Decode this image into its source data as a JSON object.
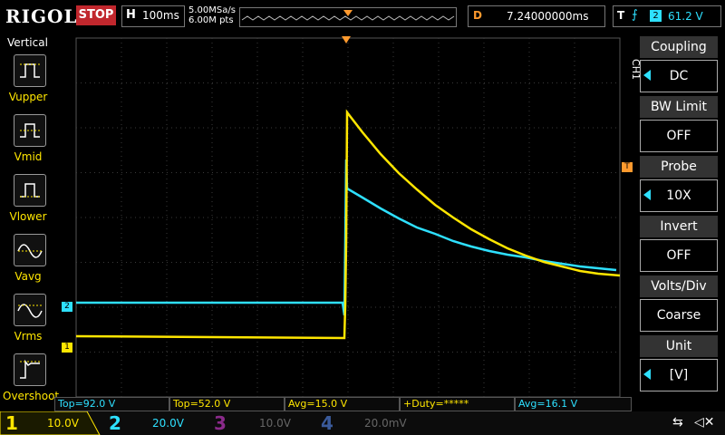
{
  "header": {
    "brand": "RIGOL",
    "run_state": "STOP",
    "timebase_key": "H",
    "timebase_value": "100ms",
    "sample_rate": "5.00MSa/s",
    "memory_depth": "6.00M pts",
    "delay_key": "D",
    "delay_value": "7.24000000ms",
    "trigger_key": "T",
    "trigger_source": "2",
    "trigger_level": "61.2 V",
    "trigger_marker": "T"
  },
  "left_menu": {
    "title": "Vertical",
    "items": [
      {
        "label": "Vupper",
        "icon": "vupper-icon"
      },
      {
        "label": "Vmid",
        "icon": "vmid-icon"
      },
      {
        "label": "Vlower",
        "icon": "vlower-icon"
      },
      {
        "label": "Vavg",
        "icon": "vavg-icon"
      },
      {
        "label": "Vrms",
        "icon": "vrms-icon"
      },
      {
        "label": "Overshoot",
        "icon": "overshoot-icon"
      }
    ]
  },
  "right_menu": {
    "channel_tag": "CH1",
    "items": [
      {
        "title": "Coupling",
        "value": "DC",
        "has_arrow": true
      },
      {
        "title": "BW Limit",
        "value": "OFF",
        "has_arrow": false
      },
      {
        "title": "Probe",
        "value": "10X",
        "has_arrow": true
      },
      {
        "title": "Invert",
        "value": "OFF",
        "has_arrow": false
      },
      {
        "title": "Volts/Div",
        "value": "Coarse",
        "has_arrow": false
      },
      {
        "title": "Unit",
        "value": "[V]",
        "has_arrow": true
      }
    ]
  },
  "measurements": [
    {
      "text": "Top=92.0 V",
      "channel": "2"
    },
    {
      "text": "Top=52.0 V",
      "channel": "1"
    },
    {
      "text": "Avg=15.0 V",
      "channel": "1"
    },
    {
      "text": "+Duty=*****",
      "channel": "1"
    },
    {
      "text": "Avg=16.1 V",
      "channel": "2"
    }
  ],
  "channels": [
    {
      "number": "1",
      "scale": "10.0V",
      "color": "#ffe600",
      "active": true
    },
    {
      "number": "2",
      "scale": "20.0V",
      "color": "#2ee0ff",
      "active": true
    },
    {
      "number": "3",
      "scale": "10.0V",
      "color": "#8a2a8a",
      "active": false
    },
    {
      "number": "4",
      "scale": "20.0mV",
      "color": "#3a5a9a",
      "active": false
    }
  ],
  "markers": {
    "ch1": "1",
    "ch2": "2"
  },
  "colors": {
    "ch1": "#ffe600",
    "ch2": "#2ee0ff",
    "stop": "#c1272d",
    "trigger": "#ff9a2e"
  }
}
